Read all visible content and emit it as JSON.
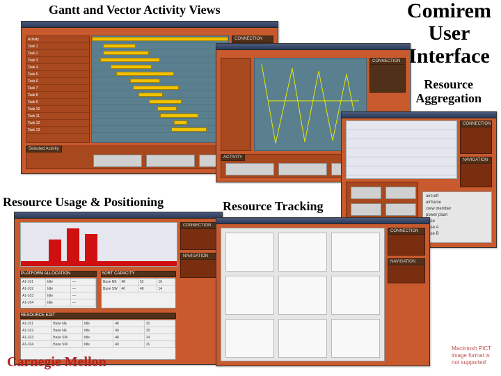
{
  "titles": {
    "top_left": "Gantt and Vector Activity Views",
    "top_right_line1": "Comirem",
    "top_right_line2": "User",
    "top_right_line3": "Interface",
    "sub_right_line1": "Resource",
    "sub_right_line2": "Aggregation",
    "usage": "Resource Usage & Positioning",
    "tracking": "Resource Tracking",
    "footer_logo": "Carnegie Mellon"
  },
  "watermark": {
    "line1": "Macintosh PICT",
    "line2": "image format is",
    "line3": "not supported"
  },
  "panels": {
    "connection": "CONNECTION",
    "navigation": "NAVIGATION",
    "activity": "ACTIVITY",
    "selected_activity": "Selected Activity",
    "platform_allocation": "PLATFORM ALLOCATION",
    "resource_edit": "RESOURCE EDIT",
    "sort_capacity": "SORT CAPACITY"
  },
  "gantt_rows": [
    {
      "label": "Activity",
      "start": 0,
      "len": 100
    },
    {
      "label": "Task 1",
      "start": 8,
      "len": 24
    },
    {
      "label": "Task 2",
      "start": 8,
      "len": 34
    },
    {
      "label": "Task 3",
      "start": 6,
      "len": 44
    },
    {
      "label": "Task 4",
      "start": 14,
      "len": 30
    },
    {
      "label": "Task 5",
      "start": 18,
      "len": 42
    },
    {
      "label": "Task 6",
      "start": 28,
      "len": 22
    },
    {
      "label": "Task 7",
      "start": 30,
      "len": 34
    },
    {
      "label": "Task 8",
      "start": 34,
      "len": 18
    },
    {
      "label": "Task 9",
      "start": 42,
      "len": 24
    },
    {
      "label": "Task 10",
      "start": 48,
      "len": 14
    },
    {
      "label": "Task 11",
      "start": 50,
      "len": 28
    },
    {
      "label": "Task 12",
      "start": 60,
      "len": 10
    },
    {
      "label": "Task 13",
      "start": 58,
      "len": 26
    }
  ],
  "usage_hist": [
    38,
    54,
    46
  ],
  "agg_tree": [
    "aircraft",
    "  airframe",
    "  crew member",
    "  power plant",
    "base",
    "  base A",
    "  base B"
  ],
  "usage_tables": {
    "alloc": [
      [
        "A1-101",
        "Idle",
        "—"
      ],
      [
        "A1-102",
        "Idle",
        "—"
      ],
      [
        "A1-103",
        "Idle",
        "—"
      ],
      [
        "A1-104",
        "Idle",
        "—"
      ]
    ],
    "capacity": [
      [
        "Base NE",
        "48",
        "52",
        "16"
      ],
      [
        "Base SW",
        "40",
        "48",
        "14"
      ]
    ],
    "edit": [
      [
        "A1-101",
        "Base NE",
        "Idle",
        "48",
        "16"
      ],
      [
        "A1-102",
        "Base NE",
        "Idle",
        "40",
        "18"
      ],
      [
        "A1-103",
        "Base SW",
        "Idle",
        "48",
        "14"
      ],
      [
        "A1-104",
        "Base SW",
        "Idle",
        "40",
        "16"
      ]
    ]
  }
}
